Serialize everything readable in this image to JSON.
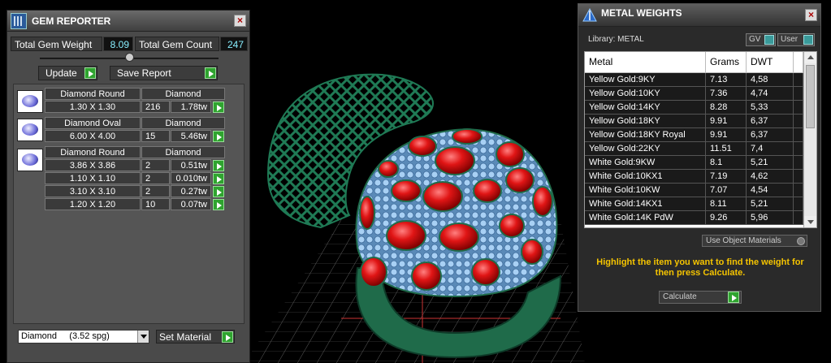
{
  "gem_reporter": {
    "title": "GEM REPORTER",
    "close_label": "×",
    "total_weight_label": "Total Gem Weight",
    "total_weight_value": "8.09",
    "total_count_label": "Total Gem Count",
    "total_count_value": "247",
    "update_label": "Update",
    "save_report_label": "Save Report",
    "groups": [
      {
        "shape": "Diamond Round",
        "material": "Diamond",
        "rows": [
          {
            "size": "1.30 X 1.30",
            "count": "216",
            "weight": "1.78tw"
          }
        ]
      },
      {
        "shape": "Diamond Oval",
        "material": "Diamond",
        "rows": [
          {
            "size": "6.00 X 4.00",
            "count": "15",
            "weight": "5.46tw"
          }
        ]
      },
      {
        "shape": "Diamond Round",
        "material": "Diamond",
        "rows": [
          {
            "size": "3.86 X 3.86",
            "count": "2",
            "weight": "0.51tw"
          },
          {
            "size": "1.10 X 1.10",
            "count": "2",
            "weight": "0.010tw"
          },
          {
            "size": "3.10 X 3.10",
            "count": "2",
            "weight": "0.27tw"
          },
          {
            "size": "1.20 X 1.20",
            "count": "10",
            "weight": "0.07tw"
          }
        ]
      }
    ],
    "material_select_value": "Diamond     (3.52 spg)",
    "set_material_label": "Set Material"
  },
  "metal_weights": {
    "title": "METAL WEIGHTS",
    "close_label": "×",
    "library_label": "Library: METAL",
    "gv_label": "GV",
    "user_label": "User",
    "columns": [
      "Metal",
      "Grams",
      "DWT"
    ],
    "rows": [
      {
        "metal": "Yellow Gold:9KY",
        "grams": "7.13",
        "dwt": "4,58"
      },
      {
        "metal": "Yellow Gold:10KY",
        "grams": "7.36",
        "dwt": "4,74"
      },
      {
        "metal": "Yellow Gold:14KY",
        "grams": "8.28",
        "dwt": "5,33"
      },
      {
        "metal": "Yellow Gold:18KY",
        "grams": "9.91",
        "dwt": "6,37"
      },
      {
        "metal": "Yellow Gold:18KY Royal",
        "grams": "9.91",
        "dwt": "6,37"
      },
      {
        "metal": "Yellow Gold:22KY",
        "grams": "11.51",
        "dwt": "7,4"
      },
      {
        "metal": "White Gold:9KW",
        "grams": "8.1",
        "dwt": "5,21"
      },
      {
        "metal": "White Gold:10KX1",
        "grams": "7.19",
        "dwt": "4,62"
      },
      {
        "metal": "White Gold:10KW",
        "grams": "7.07",
        "dwt": "4,54"
      },
      {
        "metal": "White Gold:14KX1",
        "grams": "8.11",
        "dwt": "5,21"
      },
      {
        "metal": "White Gold:14K PdW",
        "grams": "9.26",
        "dwt": "5,96"
      }
    ],
    "use_object_label": "Use Object Materials",
    "instruction": "Highlight the item you want to find the weight for then press Calculate.",
    "calculate_label": "Calculate"
  },
  "colors": {
    "panel_bg": "#4a4a4a",
    "accent_green": "#2fa42f",
    "ring_green": "#1f6b4a",
    "gem_red": "#e01515",
    "pave_blue": "#9cc8f0",
    "highlight_yellow": "#f5c400"
  }
}
